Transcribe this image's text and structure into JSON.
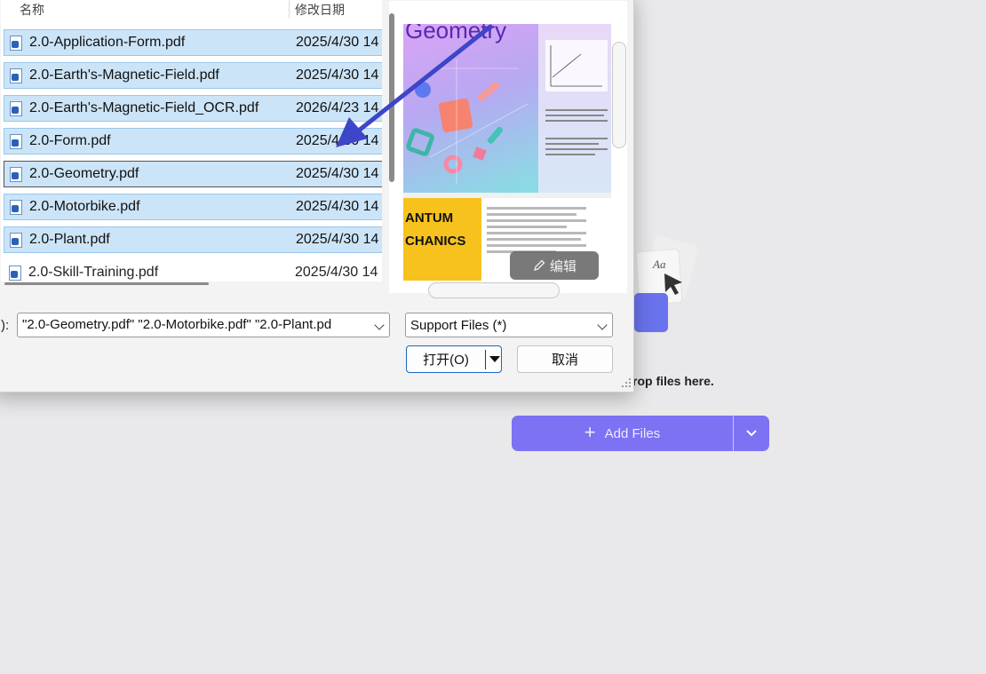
{
  "columns": {
    "name": "名称",
    "date": "修改日期"
  },
  "files": [
    {
      "name": "2.0-Application-Form.pdf",
      "date": "2025/4/30 14"
    },
    {
      "name": "2.0-Earth's-Magnetic-Field.pdf",
      "date": "2025/4/30 14"
    },
    {
      "name": "2.0-Earth's-Magnetic-Field_OCR.pdf",
      "date": "2026/4/23 14"
    },
    {
      "name": "2.0-Form.pdf",
      "date": "2025/4/30 14"
    },
    {
      "name": "2.0-Geometry.pdf",
      "date": "2025/4/30 14"
    },
    {
      "name": "2.0-Motorbike.pdf",
      "date": "2025/4/30 14"
    },
    {
      "name": "2.0-Plant.pdf",
      "date": "2025/4/30 14"
    },
    {
      "name": "2.0-Skill-Training.pdf",
      "date": "2025/4/30 14"
    }
  ],
  "preview": {
    "title": "Geometry",
    "yellow_lines": [
      "ANTUM",
      "CHANICS"
    ],
    "edit_label": "编辑"
  },
  "filename": {
    "label": "):",
    "value": "\"2.0-Geometry.pdf\" \"2.0-Motorbike.pdf\" \"2.0-Plant.pd"
  },
  "filetype": {
    "value": "Support Files (*)"
  },
  "buttons": {
    "open": "打开(O)",
    "cancel": "取消"
  },
  "app": {
    "drop_text": "rop files here.",
    "add_files": "Add Files"
  },
  "colors": {
    "accent": "#7d72f4",
    "selection": "#cce4f7",
    "arrow": "#3d45c8"
  },
  "icons": [
    "pdf-file-icon",
    "pencil-icon",
    "plus-icon",
    "chevron-down-icon",
    "resize-grip-icon"
  ]
}
